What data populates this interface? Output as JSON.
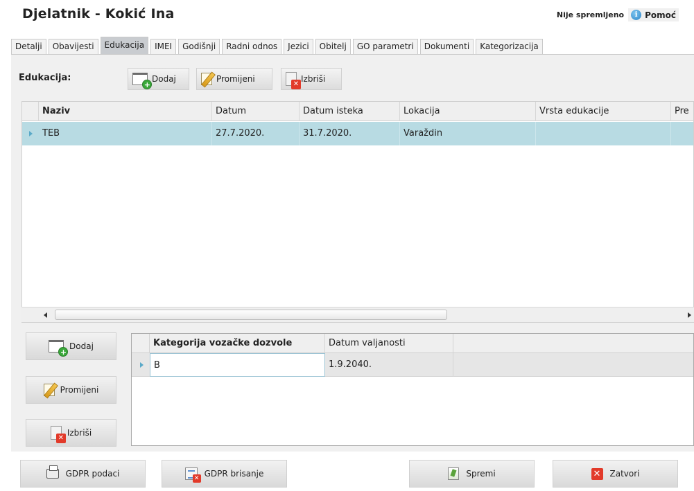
{
  "window": {
    "title": "Djelatnik - Kokić Ina",
    "status": "Nije spremljeno",
    "help_label": "Pomoć"
  },
  "tabs": [
    {
      "label": "Detalji"
    },
    {
      "label": "Obavijesti"
    },
    {
      "label": "Edukacija",
      "active": true
    },
    {
      "label": "IMEI"
    },
    {
      "label": "Godišnji"
    },
    {
      "label": "Radni odnos"
    },
    {
      "label": "Jezici"
    },
    {
      "label": "Obitelj"
    },
    {
      "label": "GO parametri"
    },
    {
      "label": "Dokumenti"
    },
    {
      "label": "Kategorizacija"
    }
  ],
  "education": {
    "section_label": "Edukacija:",
    "toolbar": {
      "add": "Dodaj",
      "edit": "Promijeni",
      "delete": "Izbriši"
    },
    "columns": [
      "Naziv",
      "Datum",
      "Datum isteka",
      "Lokacija",
      "Vrsta edukacije",
      "Pre"
    ],
    "rows": [
      {
        "naziv": "TEB",
        "datum": "27.7.2020.",
        "datum_isteka": "31.7.2020.",
        "lokacija": "Varaždin",
        "vrsta": "",
        "pre": ""
      }
    ]
  },
  "licence": {
    "buttons": {
      "add": "Dodaj",
      "edit": "Promijeni",
      "delete": "Izbriši"
    },
    "columns": [
      "Kategorija vozačke dozvole",
      "Datum valjanosti"
    ],
    "rows": [
      {
        "kategorija": "B",
        "datum_valjanosti": "1.9.2040."
      }
    ]
  },
  "footer": {
    "gdpr_data": "GDPR podaci",
    "gdpr_delete": "GDPR brisanje",
    "save": "Spremi",
    "close": "Zatvori"
  },
  "icons": {
    "help": "info-icon",
    "add": "document-add-icon",
    "edit": "pencil-icon",
    "delete": "trash-icon",
    "gdpr_data": "printer-icon",
    "gdpr_delete": "list-delete-icon",
    "save": "save-icon",
    "close": "close-icon"
  }
}
